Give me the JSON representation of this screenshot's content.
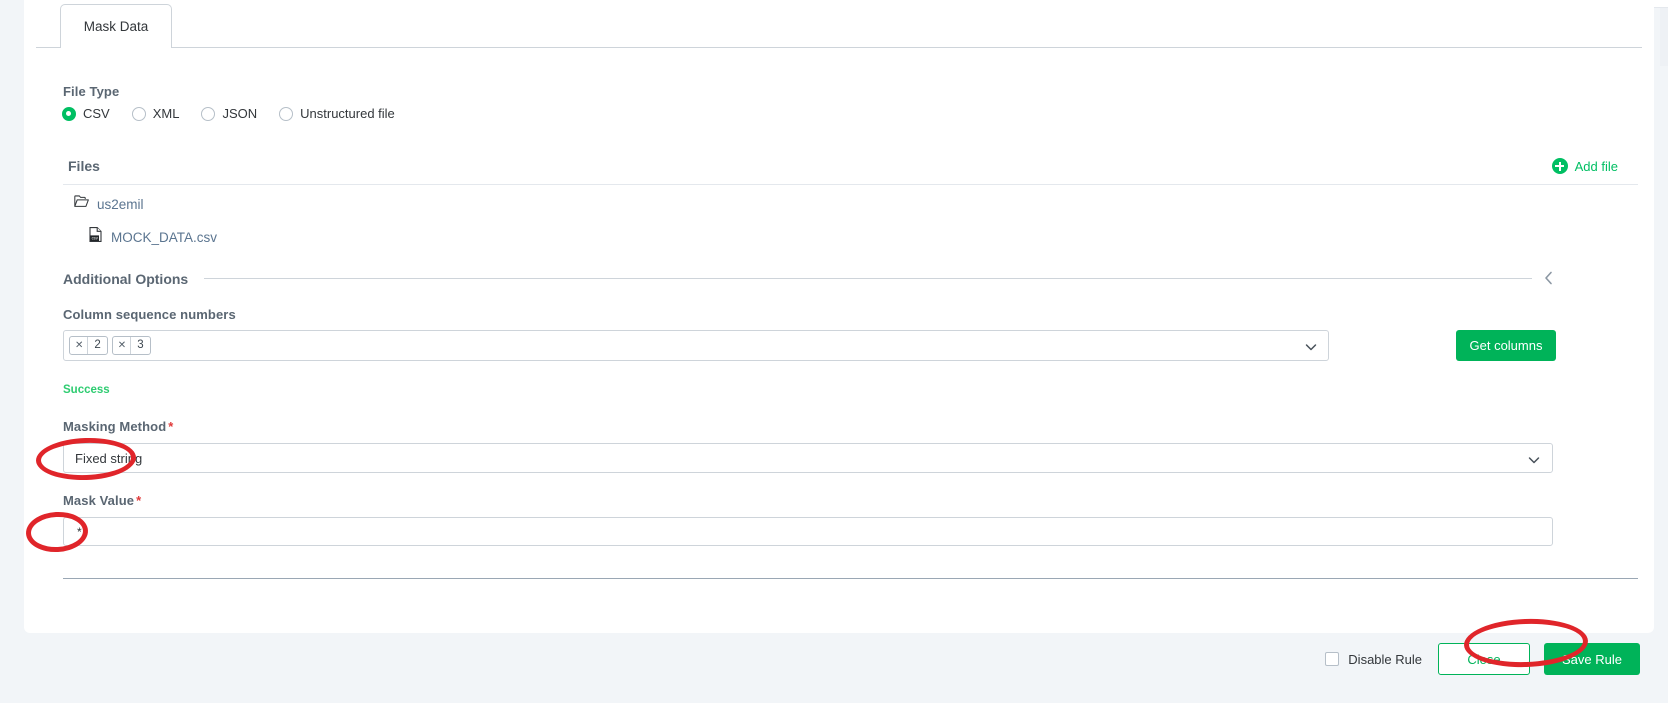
{
  "tabs": [
    {
      "label": "Mask Data",
      "active": true
    }
  ],
  "file_type": {
    "label": "File Type",
    "selected": "CSV",
    "options": [
      {
        "label": "CSV",
        "selected": true
      },
      {
        "label": "XML",
        "selected": false
      },
      {
        "label": "JSON",
        "selected": false
      },
      {
        "label": "Unstructured file",
        "selected": false
      }
    ]
  },
  "files": {
    "title": "Files",
    "add_file_label": "Add file",
    "add_file_icon": "plus-circle-icon",
    "tree": [
      {
        "type": "folder",
        "name": "us2emil",
        "icon": "open-folder-icon"
      },
      {
        "type": "file",
        "name": "MOCK_DATA.csv",
        "icon": "csv-file-icon"
      }
    ]
  },
  "additional_options": {
    "title": "Additional Options",
    "collapse_icon": "chevron-left-icon",
    "column_sequence": {
      "label": "Column sequence numbers",
      "tags": [
        "2",
        "3"
      ],
      "remove_icon": "close-x-icon",
      "dropdown_icon": "chevron-down-icon"
    },
    "get_columns_label": "Get columns",
    "status_message": "Success"
  },
  "masking_method": {
    "label": "Masking Method",
    "required_marker": "*",
    "value": "Fixed string",
    "dropdown_icon": "chevron-down-icon"
  },
  "mask_value": {
    "label": "Mask Value",
    "required_marker": "*",
    "value": "*",
    "placeholder": ""
  },
  "footer": {
    "disable_rule_label": "Disable Rule",
    "disable_rule_checked": false,
    "close_label": "Close",
    "save_label": "Save Rule"
  },
  "colors": {
    "accent_green": "#00b359",
    "radio_green": "#00bf63",
    "success_green": "#2ecc71",
    "required_red": "#e03a3a",
    "annotation_red": "#e0252a",
    "link_blue": "#5b7590",
    "label_gray": "#5a6672",
    "page_bg": "#f2f5f8"
  },
  "annotations": [
    {
      "name": "masking-method-highlight",
      "shape": "ellipse"
    },
    {
      "name": "mask-value-highlight",
      "shape": "ellipse"
    },
    {
      "name": "save-rule-highlight",
      "shape": "ellipse"
    }
  ]
}
